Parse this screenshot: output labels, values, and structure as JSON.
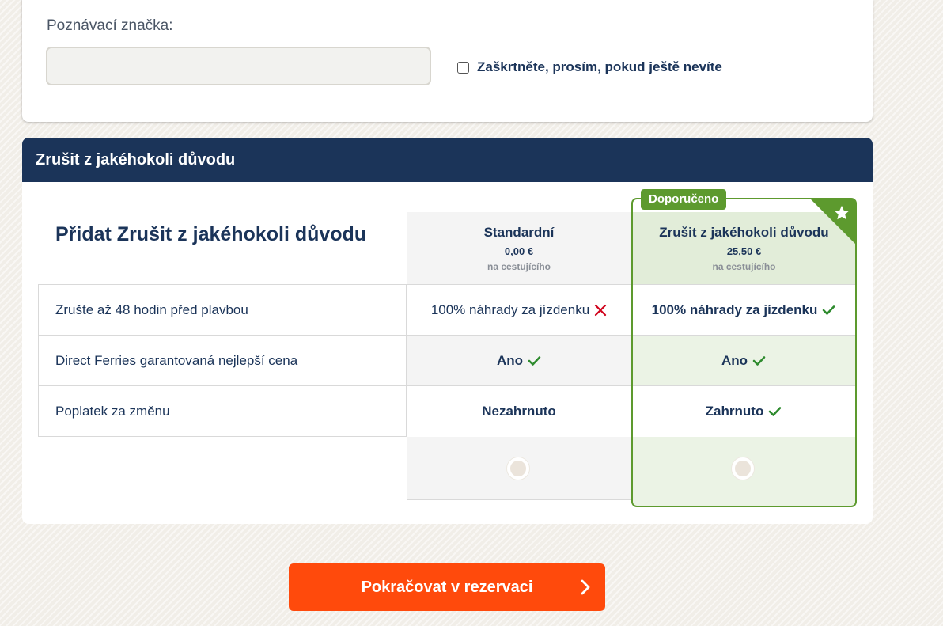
{
  "vehicle": {
    "plate_label": "Poznávací značka:",
    "plate_value": "",
    "unknown_checkbox_label": "Zaškrtněte, prosím, pokud ještě nevíte"
  },
  "cancel_section": {
    "header": "Zrušit z jakéhokoli důvodu",
    "add_title": "Přidat Zrušit z jakéhokoli důvodu",
    "badge": "Doporučeno",
    "options": [
      {
        "name": "Standardní",
        "price": "0,00 €",
        "per": "na cestujícího"
      },
      {
        "name": "Zrušit z jakéhokoli důvodu",
        "price": "25,50 €",
        "per": "na cestujícího"
      }
    ],
    "rows": [
      {
        "feature": "Zrušte až 48 hodin před plavbou",
        "standard": "100% náhrady za jízdenku",
        "recommended": "100% náhrady za jízdenku"
      },
      {
        "feature": "Direct Ferries garantovaná nejlepší cena",
        "standard": "Ano",
        "recommended": "Ano"
      },
      {
        "feature": "Poplatek za změnu",
        "standard": "Nezahrnuto",
        "recommended": "Zahrnuto"
      }
    ]
  },
  "continue_button": "Pokračovat v rezervaci",
  "colors": {
    "navy": "#1b3459",
    "green": "#5d9a2e",
    "orange": "#ff4a0c",
    "red_cross": "#d0021b"
  }
}
